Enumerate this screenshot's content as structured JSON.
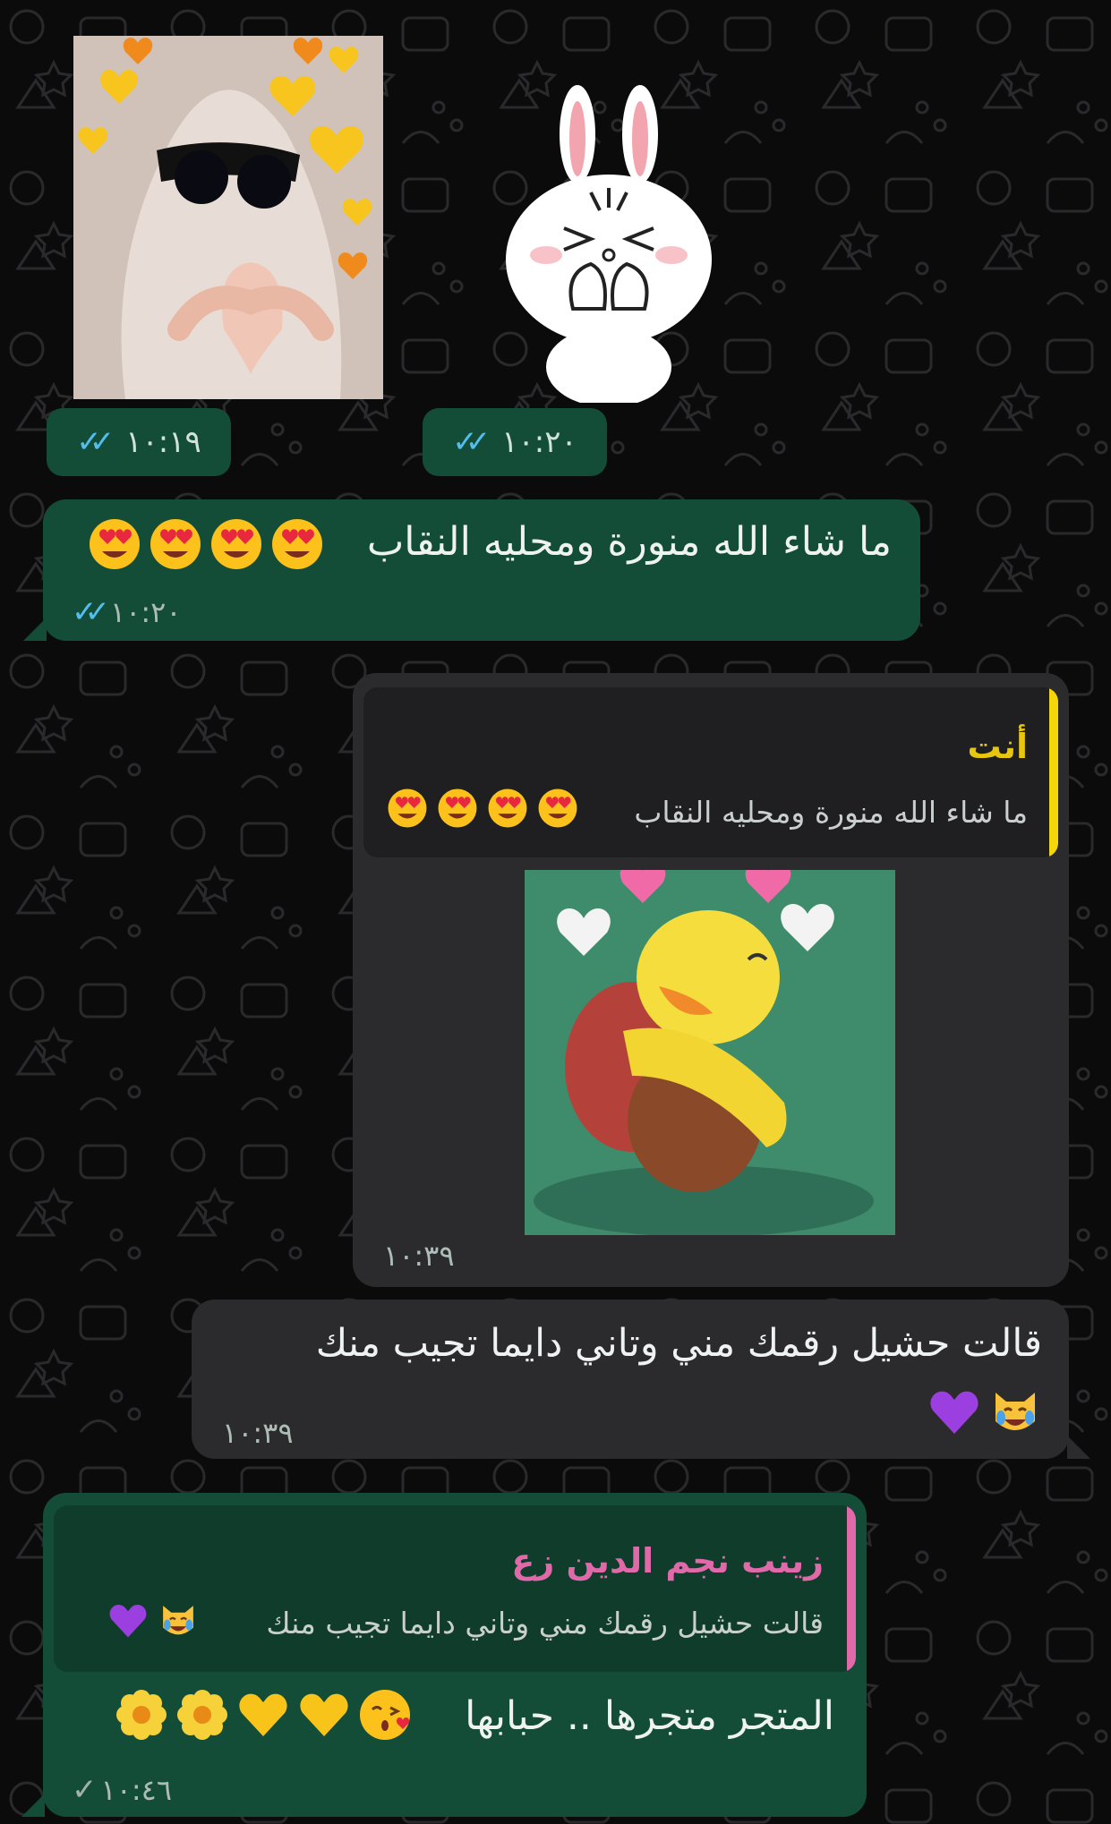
{
  "colors": {
    "outgoing_bubble": "#144d37",
    "incoming_bubble": "#2b2b2d",
    "read_ticks": "#53bdeb",
    "quote_you": "#f5d60a",
    "quote_contact": "#e06aa9"
  },
  "messages": [
    {
      "type": "sticker",
      "sticker": "veiled-girl-heart-hands",
      "time": "١٠:١٩",
      "status": "read"
    },
    {
      "type": "sticker",
      "sticker": "white-bunny-blushing",
      "time": "١٠:٢٠",
      "status": "read"
    },
    {
      "type": "text",
      "direction": "outgoing",
      "text": "ما شاء الله منورة ومحليه النقاب",
      "emojis": [
        "heart-eyes-emoji",
        "heart-eyes-emoji",
        "heart-eyes-emoji",
        "heart-eyes-emoji"
      ],
      "time": "١٠:٢٠",
      "status": "read"
    },
    {
      "type": "sticker-reply",
      "direction": "incoming",
      "quote_name": "أنت",
      "quote_text": "ما شاء الله منورة ومحليه النقاب",
      "quote_emojis": [
        "heart-eyes-emoji",
        "heart-eyes-emoji",
        "heart-eyes-emoji",
        "heart-eyes-emoji"
      ],
      "sticker": "duck-hugging-mouse",
      "time": "١٠:٣٩"
    },
    {
      "type": "text",
      "direction": "incoming",
      "text": "قالت حشيل رقمك مني وتاني دايما تجيب منك",
      "emojis": [
        "crying-laughing-cat-emoji",
        "purple-heart-emoji"
      ],
      "time": "١٠:٣٩"
    },
    {
      "type": "text-reply",
      "direction": "outgoing",
      "quote_name": "زينب نجم الدين زع",
      "quote_text": "قالت حشيل رقمك مني وتاني دايما تجيب منك",
      "quote_emojis": [
        "crying-laughing-cat-emoji",
        "purple-heart-emoji"
      ],
      "text": "المتجر متجرها .. حبابها",
      "emojis": [
        "kissing-heart-emoji",
        "yellow-heart-emoji",
        "yellow-heart-emoji",
        "blossom-emoji",
        "blossom-emoji"
      ],
      "time": "١٠:٤٦",
      "status": "sent"
    }
  ]
}
